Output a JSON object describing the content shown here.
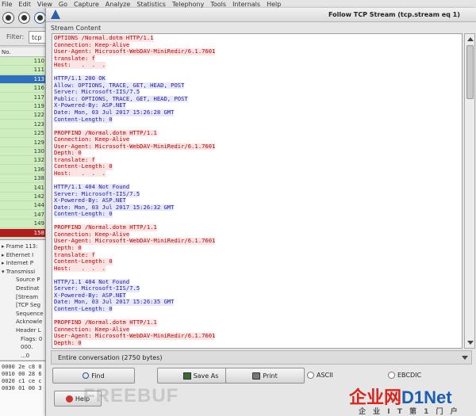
{
  "background": {
    "menu": [
      "File",
      "Edit",
      "View",
      "Go",
      "Capture",
      "Analyze",
      "Statistics",
      "Telephony",
      "Tools",
      "Internals",
      "Help"
    ],
    "filter_label": "Filter:",
    "filter_value": "tcp",
    "column_no": "No.",
    "packets": [
      "110",
      "111",
      "113",
      "116",
      "117",
      "119",
      "122",
      "123",
      "125",
      "129",
      "130",
      "132",
      "136",
      "138",
      "141",
      "142",
      "144",
      "147",
      "149",
      "158"
    ],
    "selected_packet": "113",
    "error_packet": "158",
    "details": [
      "Frame 113:",
      "Ethernet I",
      "Internet P",
      "Transmissi",
      "Source P",
      "Destinat",
      "[Stream",
      "[TCP Seg",
      "Sequence",
      "Acknowle",
      "Header L",
      "Flags: 0",
      "000.",
      "...0"
    ],
    "hex": [
      [
        "0000",
        "2e c8 0"
      ],
      [
        "0010",
        "00 28 6"
      ],
      [
        "0020",
        "c1 ce c"
      ],
      [
        "0030",
        "01 00 3"
      ]
    ]
  },
  "dialog": {
    "title": "Follow TCP Stream (tcp.stream eq 1)",
    "group_label": "Stream Content",
    "stream_lines": [
      {
        "t": "OPTIONS /Normal.dotm HTTP/1.1",
        "k": "c"
      },
      {
        "t": "Connection: Keep-Alive",
        "k": "c"
      },
      {
        "t": "User-Agent: Microsoft-WebDAV-MiniRedir/6.1.7601",
        "k": "c"
      },
      {
        "t": "translate: f",
        "k": "c"
      },
      {
        "t": "Host:   .  .  .",
        "k": "c"
      },
      {
        "t": "",
        "k": "b"
      },
      {
        "t": "HTTP/1.1 200 OK",
        "k": "s"
      },
      {
        "t": "Allow: OPTIONS, TRACE, GET, HEAD, POST",
        "k": "s"
      },
      {
        "t": "Server: Microsoft-IIS/7.5",
        "k": "s"
      },
      {
        "t": "Public: OPTIONS, TRACE, GET, HEAD, POST",
        "k": "s"
      },
      {
        "t": "X-Powered-By: ASP.NET",
        "k": "s"
      },
      {
        "t": "Date: Mon, 03 Jul 2017 15:26:28 GMT",
        "k": "s"
      },
      {
        "t": "Content-Length: 0",
        "k": "s"
      },
      {
        "t": "",
        "k": "b"
      },
      {
        "t": "PROPFIND /Normal.dotm HTTP/1.1",
        "k": "c"
      },
      {
        "t": "Connection: Keep-Alive",
        "k": "c"
      },
      {
        "t": "User-Agent: Microsoft-WebDAV-MiniRedir/6.1.7601",
        "k": "c"
      },
      {
        "t": "Depth: 0",
        "k": "c"
      },
      {
        "t": "translate: f",
        "k": "c"
      },
      {
        "t": "Content-Length: 0",
        "k": "c"
      },
      {
        "t": "Host:   .  .  .",
        "k": "c"
      },
      {
        "t": "",
        "k": "b"
      },
      {
        "t": "HTTP/1.1 404 Not Found",
        "k": "s"
      },
      {
        "t": "Server: Microsoft-IIS/7.5",
        "k": "s"
      },
      {
        "t": "X-Powered-By: ASP.NET",
        "k": "s"
      },
      {
        "t": "Date: Mon, 03 Jul 2017 15:26:32 GMT",
        "k": "s"
      },
      {
        "t": "Content-Length: 0",
        "k": "s"
      },
      {
        "t": "",
        "k": "b"
      },
      {
        "t": "PROPFIND /Normal.dotm HTTP/1.1",
        "k": "c"
      },
      {
        "t": "Connection: Keep-Alive",
        "k": "c"
      },
      {
        "t": "User-Agent: Microsoft-WebDAV-MiniRedir/6.1.7601",
        "k": "c"
      },
      {
        "t": "Depth: 0",
        "k": "c"
      },
      {
        "t": "translate: f",
        "k": "c"
      },
      {
        "t": "Content-Length: 0",
        "k": "c"
      },
      {
        "t": "Host:   .  .  .",
        "k": "c"
      },
      {
        "t": "",
        "k": "b"
      },
      {
        "t": "HTTP/1.1 404 Not Found",
        "k": "s"
      },
      {
        "t": "Server: Microsoft-IIS/7.5",
        "k": "s"
      },
      {
        "t": "X-Powered-By: ASP.NET",
        "k": "s"
      },
      {
        "t": "Date: Mon, 03 Jul 2017 15:26:35 GMT",
        "k": "s"
      },
      {
        "t": "Content-Length: 0",
        "k": "s"
      },
      {
        "t": "",
        "k": "b"
      },
      {
        "t": "PROPFIND /Normal.dotm HTTP/1.1",
        "k": "c"
      },
      {
        "t": "Connection: Keep-Alive",
        "k": "c"
      },
      {
        "t": "User-Agent: Microsoft-WebDAV-MiniRedir/6.1.7601",
        "k": "c"
      },
      {
        "t": "Depth: 0",
        "k": "c"
      }
    ],
    "conversation": "Entire conversation (2750 bytes)",
    "buttons": {
      "find": "Find",
      "save_as": "Save As",
      "print": "Print",
      "help": "Help"
    },
    "format": {
      "ascii": "ASCII",
      "ebcdic": "EBCDIC"
    }
  },
  "watermarks": {
    "freebuf": "FREEBUF",
    "logo_a": "企业网",
    "logo_b": "D1Net",
    "sub": "企 业 I T 第 1 门 户"
  }
}
